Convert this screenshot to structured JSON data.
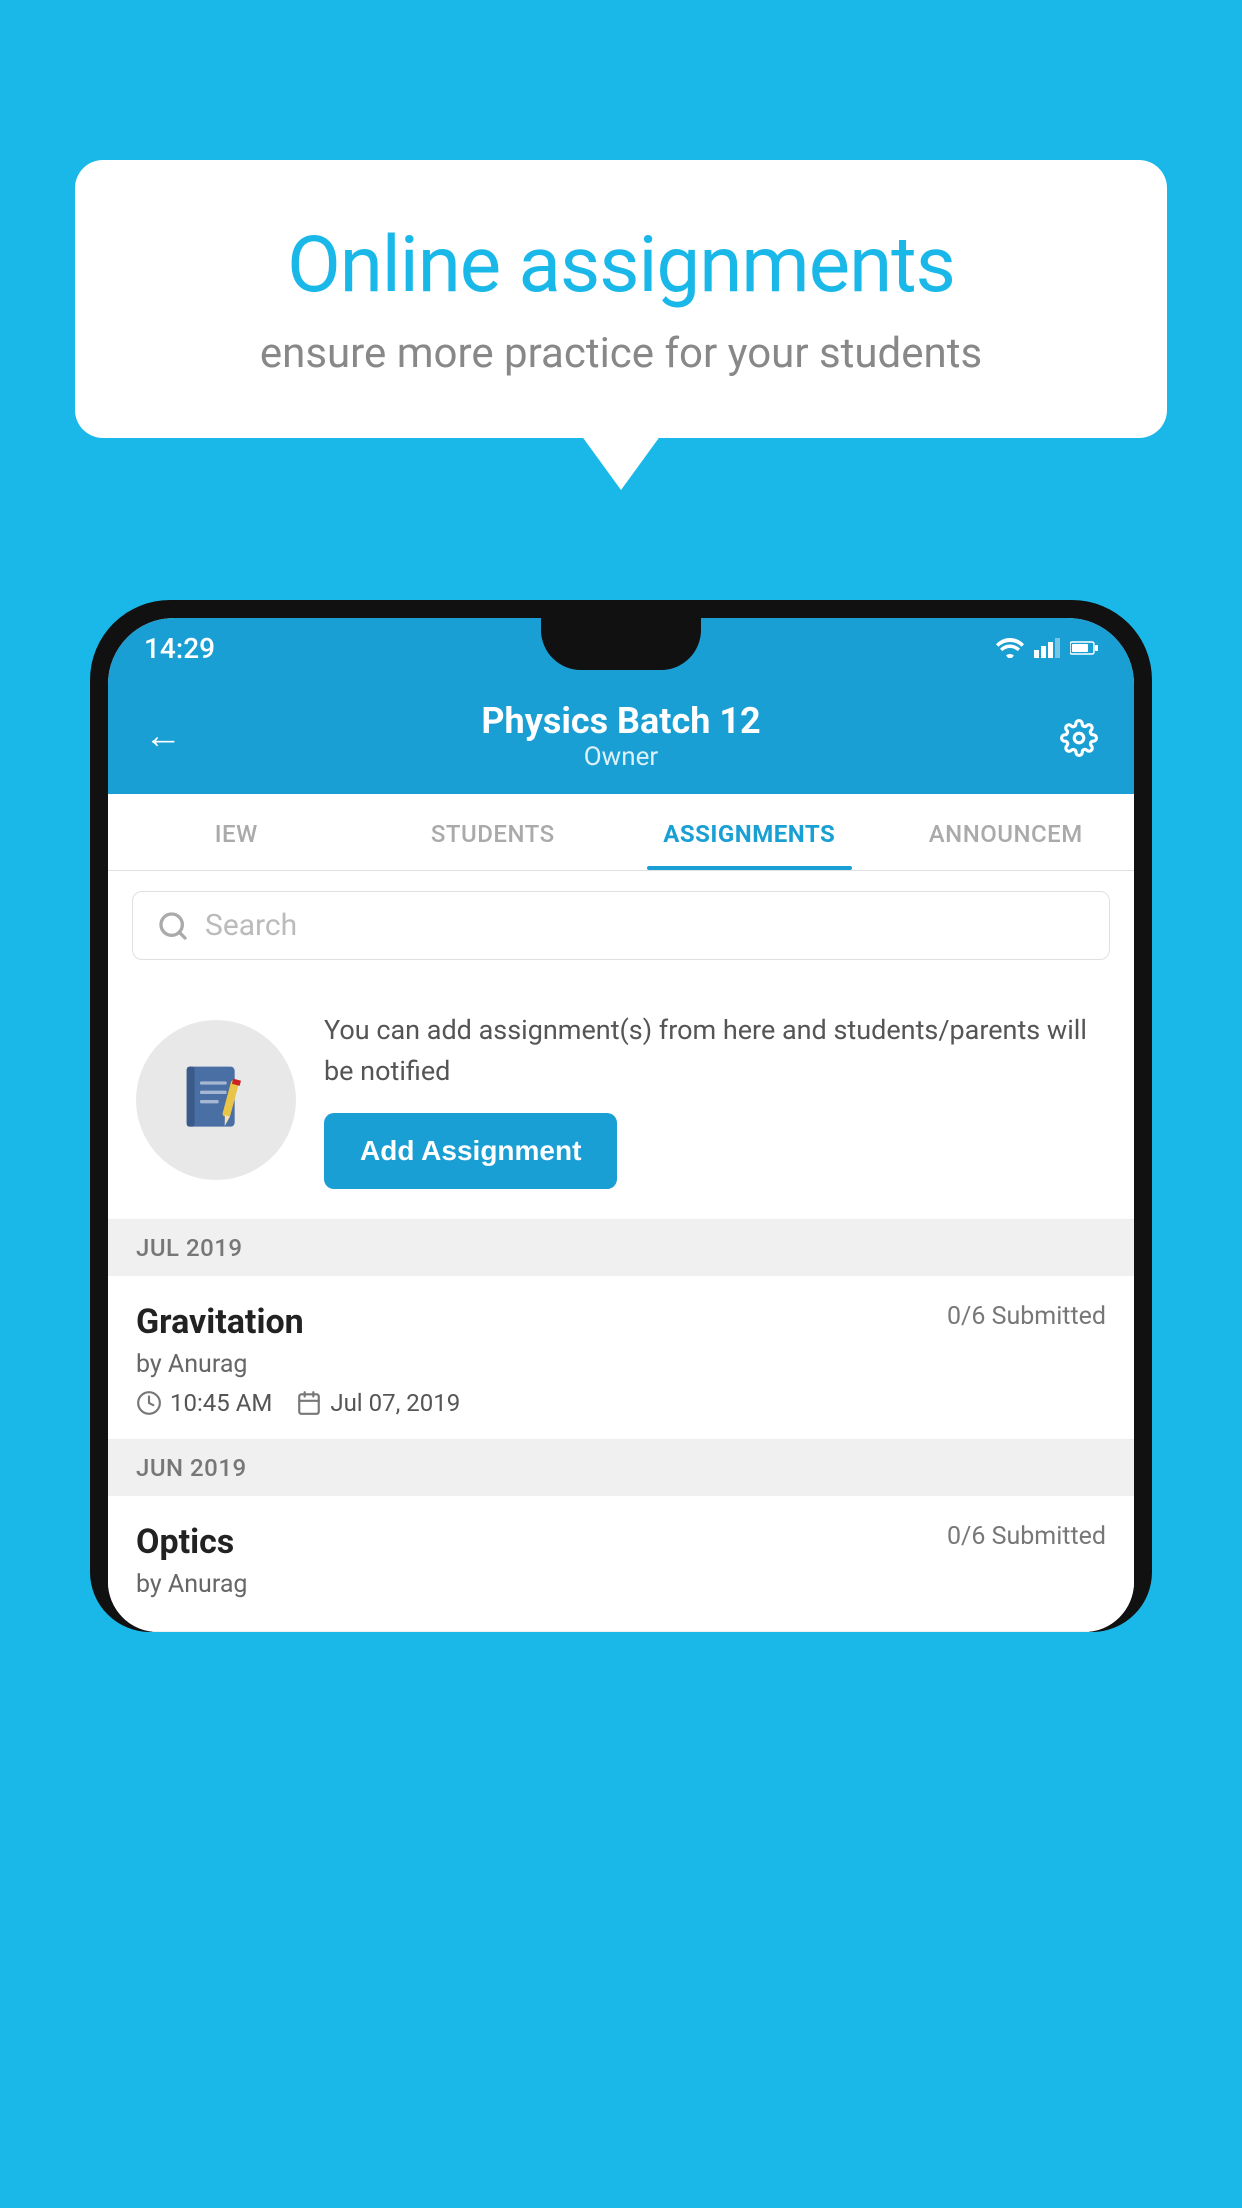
{
  "background_color": "#1ab8e8",
  "speech_bubble": {
    "title": "Online assignments",
    "subtitle": "ensure more practice for your students"
  },
  "phone": {
    "status_bar": {
      "time": "14:29",
      "icons": [
        "wifi",
        "signal",
        "battery"
      ]
    },
    "header": {
      "title": "Physics Batch 12",
      "subtitle": "Owner",
      "back_label": "←",
      "settings_label": "⚙"
    },
    "tabs": [
      {
        "label": "IEW",
        "active": false
      },
      {
        "label": "STUDENTS",
        "active": false
      },
      {
        "label": "ASSIGNMENTS",
        "active": true
      },
      {
        "label": "ANNOUNCEM",
        "active": false
      }
    ],
    "search": {
      "placeholder": "Search"
    },
    "promo": {
      "text": "You can add assignment(s) from here and students/parents will be notified",
      "button_label": "Add Assignment"
    },
    "sections": [
      {
        "label": "JUL 2019",
        "assignments": [
          {
            "name": "Gravitation",
            "submitted": "0/6 Submitted",
            "by": "by Anurag",
            "time": "10:45 AM",
            "date": "Jul 07, 2019"
          }
        ]
      },
      {
        "label": "JUN 2019",
        "assignments": [
          {
            "name": "Optics",
            "submitted": "0/6 Submitted",
            "by": "by Anurag",
            "time": "",
            "date": ""
          }
        ]
      }
    ]
  }
}
